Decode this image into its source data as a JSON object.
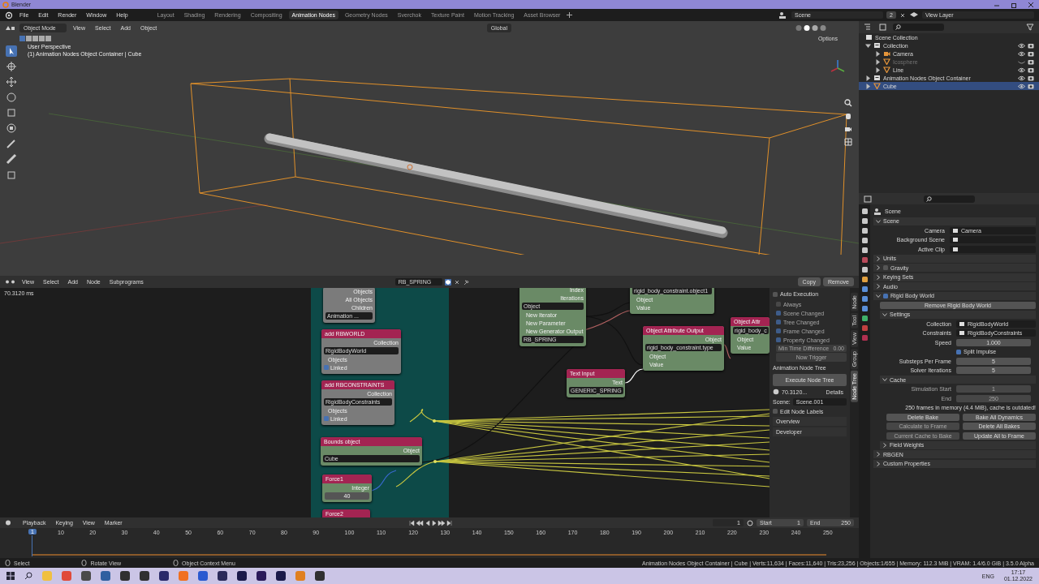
{
  "window": {
    "title": "Blender"
  },
  "menu": [
    "File",
    "Edit",
    "Render",
    "Window",
    "Help"
  ],
  "workspaces": [
    {
      "label": "Layout",
      "selected": false
    },
    {
      "label": "Shading",
      "selected": false
    },
    {
      "label": "Rendering",
      "selected": false
    },
    {
      "label": "Compositing",
      "selected": false
    },
    {
      "label": "Animation Nodes",
      "selected": true
    },
    {
      "label": "Geometry Nodes",
      "selected": false
    },
    {
      "label": "Sverchok",
      "selected": false
    },
    {
      "label": "Texture Paint",
      "selected": false
    },
    {
      "label": "Motion Tracking",
      "selected": false
    },
    {
      "label": "Asset Browser",
      "selected": false
    }
  ],
  "scene_field": {
    "value": "Scene",
    "users": "2"
  },
  "view_layer": {
    "value": "View Layer"
  },
  "viewport": {
    "mode": "Object Mode",
    "menus": [
      "View",
      "Select",
      "Add",
      "Object"
    ],
    "orientation": "Global",
    "options": "Options",
    "perspective": "User Perspective",
    "object_info": "(1) Animation Nodes Object Container | Cube"
  },
  "outliner": {
    "root": "Scene Collection",
    "items": [
      {
        "name": "Collection",
        "kind": "collection",
        "expanded": true,
        "selected": false,
        "hidden": false,
        "children": [
          {
            "name": "Camera",
            "kind": "camera",
            "expanded": false,
            "selected": false,
            "hidden": false
          },
          {
            "name": "Icosphere",
            "kind": "mesh",
            "expanded": false,
            "selected": false,
            "hidden": true
          },
          {
            "name": "Line",
            "kind": "mesh",
            "expanded": false,
            "selected": false,
            "hidden": false
          }
        ]
      },
      {
        "name": "Animation Nodes Object Container",
        "kind": "collection",
        "expanded": false,
        "selected": false,
        "hidden": false
      },
      {
        "name": "Cube",
        "kind": "mesh",
        "expanded": false,
        "selected": true,
        "hidden": false
      }
    ]
  },
  "properties": {
    "context": "Scene",
    "panels": [
      {
        "kind": "panel",
        "title": "Scene",
        "expanded": true,
        "children": [
          {
            "kind": "field",
            "label": "Camera",
            "value": "Camera"
          },
          {
            "kind": "field",
            "label": "Background Scene"
          },
          {
            "kind": "field",
            "label": "Active Clip"
          }
        ]
      },
      {
        "kind": "panel",
        "title": "Units",
        "expanded": false
      },
      {
        "kind": "panel",
        "title": "Gravity",
        "expanded": false,
        "checked": false
      },
      {
        "kind": "panel",
        "title": "Keying Sets",
        "expanded": false
      },
      {
        "kind": "panel",
        "title": "Audio",
        "expanded": false
      },
      {
        "kind": "panel",
        "title": "Rigid Body World",
        "expanded": true,
        "checked": true,
        "children": [
          {
            "kind": "button",
            "label": "Remove Rigid Body World"
          },
          {
            "kind": "panel",
            "title": "Settings",
            "expanded": true,
            "children": [
              {
                "kind": "field",
                "label": "Collection",
                "value": "RigidBodyWorld"
              },
              {
                "kind": "field",
                "label": "Constraints",
                "value": "RigidBodyConstraints"
              },
              {
                "kind": "number",
                "label": "Speed",
                "value": "1.000",
                "disabled": false
              },
              {
                "kind": "check",
                "label": "Split Impulse",
                "checked": true
              },
              {
                "kind": "number",
                "label": "Substeps Per Frame",
                "value": "5",
                "disabled": false
              },
              {
                "kind": "number",
                "label": "Solver Iterations",
                "value": "5",
                "disabled": false
              }
            ]
          },
          {
            "kind": "panel",
            "title": "Cache",
            "expanded": true,
            "children": [
              {
                "kind": "number",
                "label": "Simulation Start",
                "value": "1",
                "disabled": true
              },
              {
                "kind": "number",
                "label": "End",
                "value": "250",
                "disabled": true
              },
              {
                "kind": "info",
                "text": "250 frames in memory (4.4 MiB), cache is outdated!"
              },
              {
                "kind": "pair",
                "buttons": [
                  {
                    "label": "Delete Bake",
                    "disabled": false
                  },
                  {
                    "label": "Bake All Dynamics",
                    "disabled": false
                  }
                ]
              },
              {
                "kind": "pair",
                "buttons": [
                  {
                    "label": "Calculate to Frame",
                    "disabled": true
                  },
                  {
                    "label": "Delete All Bakes",
                    "disabled": false
                  }
                ]
              },
              {
                "kind": "pair",
                "buttons": [
                  {
                    "label": "Current Cache to Bake",
                    "disabled": true
                  },
                  {
                    "label": "Update All to Frame",
                    "disabled": false
                  }
                ]
              }
            ]
          },
          {
            "kind": "panel",
            "title": "Field Weights",
            "expanded": false
          }
        ]
      },
      {
        "kind": "panel",
        "title": "RBGEN",
        "expanded": false
      },
      {
        "kind": "panel",
        "title": "Custom Properties",
        "expanded": false
      }
    ]
  },
  "node_editor": {
    "menus": [
      "View",
      "Select",
      "Add",
      "Node",
      "Subprograms"
    ],
    "tree": "RB_SPRING",
    "copy": "Copy",
    "remove": "Remove",
    "timing": "70.3120 ms",
    "nodes": [
      {
        "kind": "script",
        "rows": [
          {
            "kind": "output",
            "label": "Objects"
          },
          {
            "kind": "output",
            "label": "All Objects"
          },
          {
            "kind": "output",
            "label": "Children"
          },
          {
            "kind": "field",
            "value": "Animation ..."
          }
        ]
      },
      {
        "kind": "script",
        "title": "add RBWORLD",
        "rows": [
          {
            "kind": "output",
            "label": "Collection"
          },
          {
            "kind": "field",
            "value": "RigidBodyWorld"
          },
          {
            "kind": "input",
            "label": "Objects"
          },
          {
            "kind": "check",
            "label": "Linked",
            "checked": true
          }
        ]
      },
      {
        "kind": "script",
        "title": "add RBCONSTRAINTS",
        "rows": [
          {
            "kind": "output",
            "label": "Collection"
          },
          {
            "kind": "field",
            "value": "RigidBodyConstraints"
          },
          {
            "kind": "input",
            "label": "Objects"
          },
          {
            "kind": "check",
            "label": "Linked",
            "checked": true
          }
        ]
      },
      {
        "kind": "data",
        "title": "Bounds object",
        "rows": [
          {
            "kind": "output",
            "label": "Object"
          },
          {
            "kind": "field",
            "value": "Cube"
          }
        ]
      },
      {
        "kind": "data",
        "title": "Force1",
        "rows": [
          {
            "kind": "output",
            "label": "Integer"
          },
          {
            "kind": "number",
            "value": "40"
          }
        ]
      },
      {
        "kind": "data",
        "title": "Force2"
      },
      {
        "kind": "data",
        "rows": [
          {
            "kind": "output",
            "label": "Index"
          },
          {
            "kind": "output",
            "label": "Iterations"
          },
          {
            "kind": "field",
            "value": "Object"
          },
          {
            "kind": "input",
            "label": "New Iterator"
          },
          {
            "kind": "input",
            "label": "New Parameter"
          },
          {
            "kind": "input",
            "label": "New Generator Output"
          },
          {
            "kind": "field",
            "value": "RB_SPRING"
          }
        ]
      },
      {
        "kind": "data",
        "rows": [
          {
            "kind": "field",
            "value": "rigid_body_constraint.object1"
          },
          {
            "kind": "input",
            "label": "Object"
          },
          {
            "kind": "input",
            "label": "Value"
          }
        ]
      },
      {
        "kind": "data",
        "title": "Object Attribute Output",
        "rows": [
          {
            "kind": "output",
            "label": "Object"
          },
          {
            "kind": "field",
            "value": "rigid_body_constraint.type"
          },
          {
            "kind": "input",
            "label": "Object"
          },
          {
            "kind": "input",
            "label": "Value"
          }
        ]
      },
      {
        "kind": "data",
        "title": "Text Input",
        "rows": [
          {
            "kind": "output",
            "label": "Text"
          },
          {
            "kind": "field",
            "value": "GENERIC_SPRING"
          }
        ]
      },
      {
        "kind": "data",
        "title": "Object Attr",
        "rows": [
          {
            "kind": "field",
            "value": "rigid_body_c"
          },
          {
            "kind": "input",
            "label": "Object"
          },
          {
            "kind": "input",
            "label": "Value"
          }
        ]
      }
    ],
    "sidebar": {
      "auto_execution": {
        "label": "Auto Execution",
        "checked": false,
        "options": [
          {
            "label": "Always",
            "checked": false
          },
          {
            "label": "Scene Changed",
            "checked": true
          },
          {
            "label": "Tree Changed",
            "checked": true
          },
          {
            "label": "Frame Changed",
            "checked": true
          },
          {
            "label": "Property Changed",
            "checked": true
          }
        ],
        "min_time": {
          "label": "Min Time Difference",
          "value": "0.00"
        },
        "trigger": "Now Trigger"
      },
      "tree_panel": {
        "label": "Animation Node Tree",
        "execute": "Execute Node Tree",
        "time": "70.3120...",
        "details": "Details",
        "scene_label": "Scene:",
        "scene": "Scene.001",
        "edit_labels": {
          "label": "Edit Node Labels",
          "checked": false
        }
      },
      "collapsed": [
        "Overview",
        "Developer"
      ],
      "tabs": [
        {
          "label": "Node",
          "selected": false
        },
        {
          "label": "Tool",
          "selected": false
        },
        {
          "label": "View",
          "selected": false
        },
        {
          "label": "Group",
          "selected": false
        },
        {
          "label": "Node Tree",
          "selected": true
        }
      ]
    }
  },
  "timeline": {
    "menus": [
      "Playback",
      "Keying",
      "View",
      "Marker"
    ],
    "current": "1",
    "frame": "1",
    "start_label": "Start",
    "start": "1",
    "end_label": "End",
    "end": "250",
    "ticks": [
      "10",
      "20",
      "30",
      "40",
      "50",
      "60",
      "70",
      "80",
      "90",
      "100",
      "110",
      "120",
      "130",
      "140",
      "150",
      "160",
      "170",
      "180",
      "190",
      "200",
      "210",
      "220",
      "230",
      "240",
      "250"
    ]
  },
  "status": {
    "hints": [
      "Select",
      "Rotate View",
      "Object Context Menu"
    ],
    "stats": "Animation Nodes Object Container | Cube | Verts:11,634 | Faces:11,640 | Tris:23,256 | Objects:1/655 | Memory: 112.3 MiB | VRAM: 1.4/6.0 GiB | 3.5.0 Alpha"
  },
  "taskbar": {
    "lang": "ENG",
    "time": "17:17",
    "date": "01.12.2022"
  }
}
